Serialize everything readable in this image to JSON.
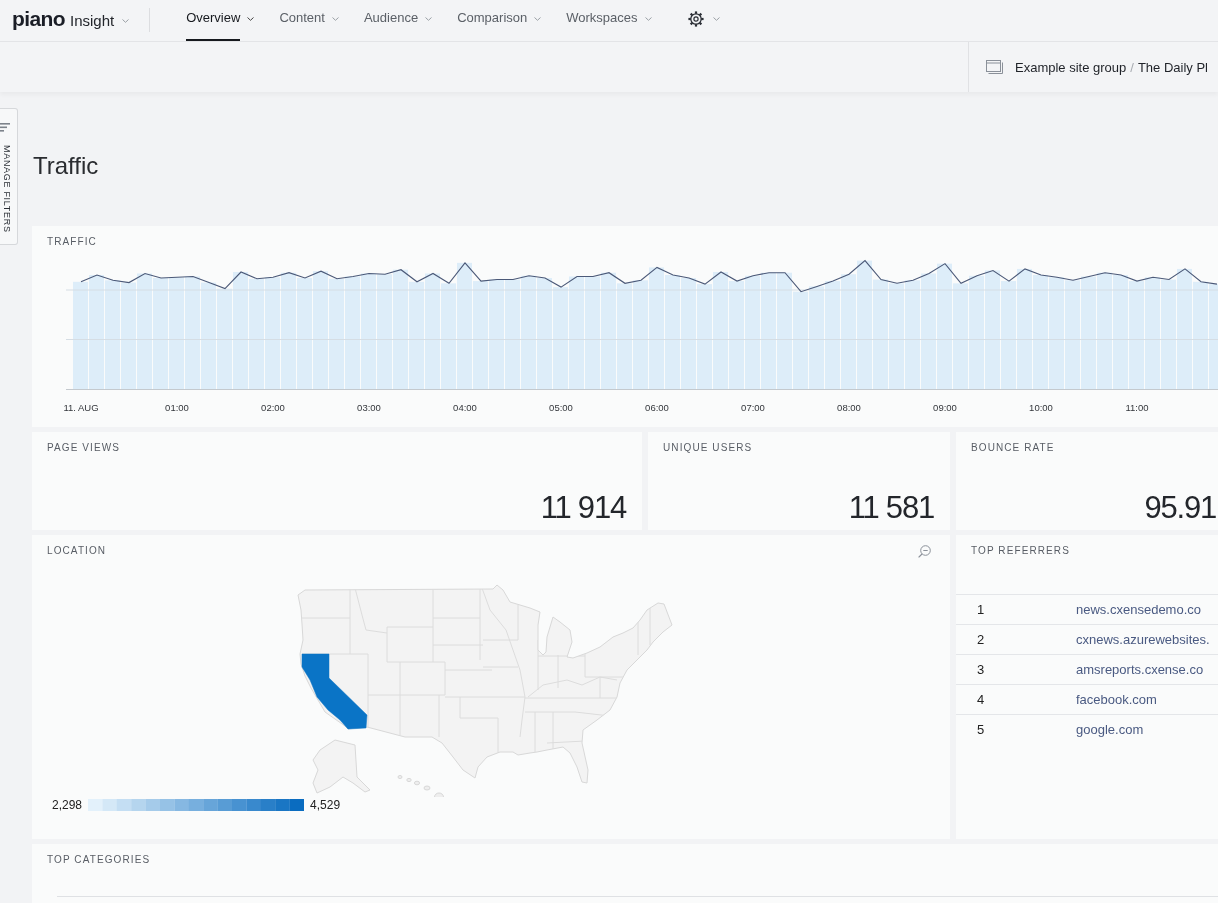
{
  "header": {
    "logo": "piano",
    "product": "Insight",
    "tabs": [
      {
        "label": "Overview",
        "selected": true
      },
      {
        "label": "Content",
        "selected": false
      },
      {
        "label": "Audience",
        "selected": false
      },
      {
        "label": "Comparison",
        "selected": false
      },
      {
        "label": "Workspaces",
        "selected": false
      }
    ]
  },
  "breadcrumb": {
    "items": [
      "Example site group",
      "The Daily Pl"
    ],
    "separator": "/"
  },
  "filters_tab": {
    "label": "MANAGE FILTERS"
  },
  "page_title": "Traffic",
  "traffic": {
    "title": "TRAFFIC",
    "x_labels": [
      "11. AUG",
      "01:00",
      "02:00",
      "03:00",
      "04:00",
      "05:00",
      "06:00",
      "07:00",
      "08:00",
      "09:00",
      "10:00",
      "11:00"
    ]
  },
  "stats": [
    {
      "title": "PAGE VIEWS",
      "value": "11 914"
    },
    {
      "title": "UNIQUE USERS",
      "value": "11 581"
    },
    {
      "title": "BOUNCE RATE",
      "value": "95.91"
    }
  ],
  "location": {
    "title": "LOCATION",
    "legend_min": "2,298",
    "legend_max": "4,529"
  },
  "top_referrers": {
    "title": "TOP REFERRERS",
    "rows": [
      {
        "rank": "1",
        "domain": "news.cxensedemo.co"
      },
      {
        "rank": "2",
        "domain": "cxnews.azurewebsites."
      },
      {
        "rank": "3",
        "domain": "amsreports.cxense.co"
      },
      {
        "rank": "4",
        "domain": "facebook.com"
      },
      {
        "rank": "5",
        "domain": "google.com"
      }
    ]
  },
  "top_categories": {
    "title": "TOP CATEGORIES"
  }
}
